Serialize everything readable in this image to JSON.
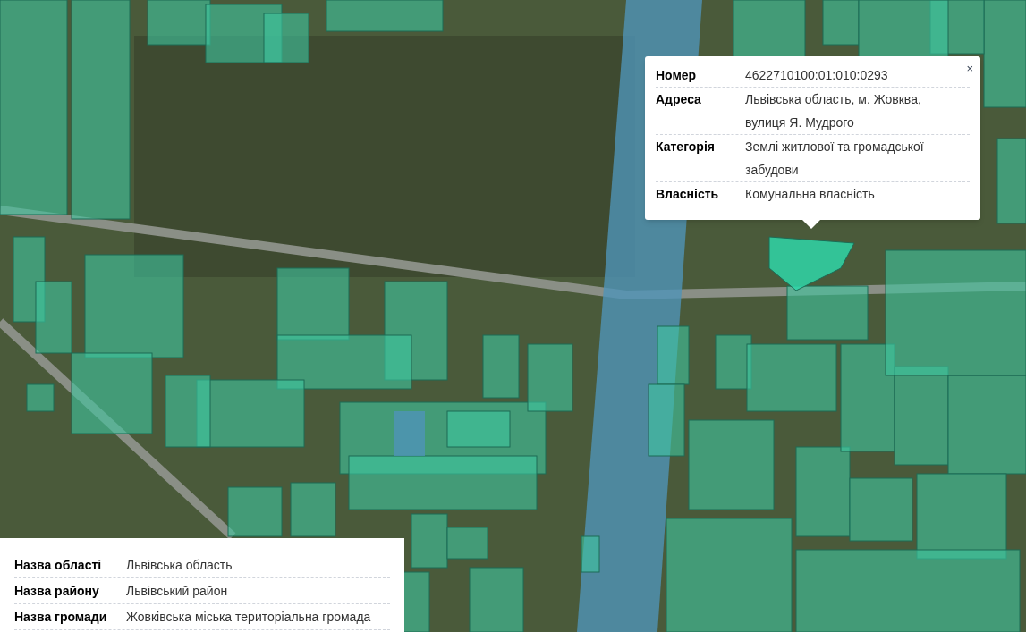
{
  "popup": {
    "close": "×",
    "rows": [
      {
        "label": "Номер",
        "value": "4622710100:01:010:0293"
      },
      {
        "label": "Адреса",
        "value": "Львівська область, м. Жовква, вулиця Я. Мудрого"
      },
      {
        "label": "Категорія",
        "value": "Землі житлової та громадської забудови"
      },
      {
        "label": "Власність",
        "value": "Комунальна власність"
      }
    ]
  },
  "info_panel": {
    "rows": [
      {
        "label": "Назва області",
        "value": "Львівська область"
      },
      {
        "label": "Назва району",
        "value": "Львівський район"
      },
      {
        "label": "Назва громади",
        "value": "Жовківська міська територіальна громада"
      }
    ]
  }
}
